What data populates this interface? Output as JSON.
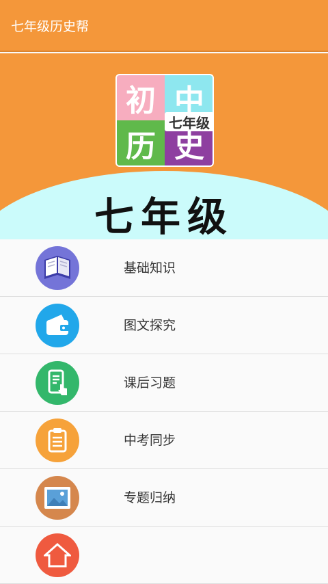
{
  "app_bar": {
    "title": "七年级历史帮"
  },
  "banner": {
    "logo": {
      "tl": "初",
      "tr": "中",
      "bl": "历",
      "br": "史",
      "sub": "七年级"
    },
    "grade": "七年级"
  },
  "menu": {
    "items": [
      {
        "label": "基础知识",
        "icon": "book-icon",
        "color": "#7474d8"
      },
      {
        "label": "图文探究",
        "icon": "wallet-icon",
        "color": "#21a7ea"
      },
      {
        "label": "课后习题",
        "icon": "phone-touch-icon",
        "color": "#33b76b"
      },
      {
        "label": "中考同步",
        "icon": "clipboard-icon",
        "color": "#f6a23a"
      },
      {
        "label": "专题归纳",
        "icon": "picture-icon",
        "color": "#d5874d"
      },
      {
        "label": "",
        "icon": "home-icon",
        "color": "#ef5a3f"
      }
    ]
  },
  "colors": {
    "app_bar": "#f4973a",
    "wave": "#cbfbfb"
  }
}
